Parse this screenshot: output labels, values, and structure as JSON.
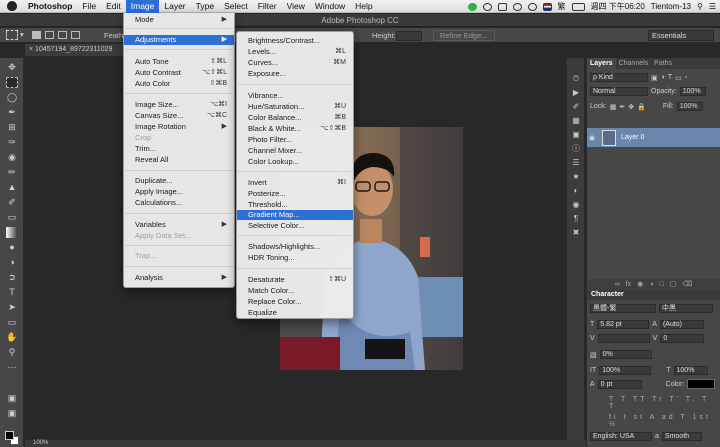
{
  "menubar": {
    "app": "Photoshop",
    "items": [
      "File",
      "Edit",
      "Image",
      "Layer",
      "Type",
      "Select",
      "Filter",
      "View",
      "Window",
      "Help"
    ],
    "active": "Image",
    "status": {
      "input": "繁",
      "clock": "週四 下午06:20",
      "user": "Tientom-13"
    }
  },
  "window": {
    "title": "Adobe Photoshop CC"
  },
  "options": {
    "feather_label": "Feath",
    "height_label": "Height:",
    "refine_label": "Refine Edge...",
    "workspace": "Essentials"
  },
  "document": {
    "tab": "10457194_89722311029",
    "zoom": "100%"
  },
  "image_menu": [
    {
      "label": "Mode",
      "submenu": true
    },
    {
      "label": "Adjustments",
      "submenu": true,
      "highlight": true
    },
    {
      "label": "Auto Tone",
      "shortcut": "⇧⌘L"
    },
    {
      "label": "Auto Contrast",
      "shortcut": "⌥⇧⌘L"
    },
    {
      "label": "Auto Color",
      "shortcut": "⇧⌘B"
    },
    {
      "label": "Image Size...",
      "shortcut": "⌥⌘I"
    },
    {
      "label": "Canvas Size...",
      "shortcut": "⌥⌘C"
    },
    {
      "label": "Image Rotation",
      "submenu": true
    },
    {
      "label": "Crop",
      "disabled": true
    },
    {
      "label": "Trim..."
    },
    {
      "label": "Reveal All"
    },
    {
      "label": "Duplicate..."
    },
    {
      "label": "Apply Image..."
    },
    {
      "label": "Calculations..."
    },
    {
      "label": "Variables",
      "submenu": true
    },
    {
      "label": "Apply Data Set...",
      "disabled": true
    },
    {
      "label": "Trap...",
      "disabled": true
    },
    {
      "label": "Analysis",
      "submenu": true
    }
  ],
  "adjustments_menu": [
    {
      "label": "Brightness/Contrast..."
    },
    {
      "label": "Levels...",
      "shortcut": "⌘L"
    },
    {
      "label": "Curves...",
      "shortcut": "⌘M"
    },
    {
      "label": "Exposure..."
    },
    {
      "label": "Vibrance..."
    },
    {
      "label": "Hue/Saturation...",
      "shortcut": "⌘U"
    },
    {
      "label": "Color Balance...",
      "shortcut": "⌘B"
    },
    {
      "label": "Black & White...",
      "shortcut": "⌥⇧⌘B"
    },
    {
      "label": "Photo Filter..."
    },
    {
      "label": "Channel Mixer..."
    },
    {
      "label": "Color Lookup..."
    },
    {
      "label": "Invert",
      "shortcut": "⌘I"
    },
    {
      "label": "Posterize..."
    },
    {
      "label": "Threshold..."
    },
    {
      "label": "Gradient Map...",
      "highlight": true
    },
    {
      "label": "Selective Color..."
    },
    {
      "label": "Shadows/Highlights..."
    },
    {
      "label": "HDR Toning..."
    },
    {
      "label": "Desaturate",
      "shortcut": "⇧⌘U"
    },
    {
      "label": "Match Color..."
    },
    {
      "label": "Replace Color..."
    },
    {
      "label": "Equalize"
    }
  ],
  "layers_panel": {
    "tabs": [
      "Layers",
      "Channels",
      "Paths"
    ],
    "kind": "ρ Kind",
    "blend_mode": "Normal",
    "opacity_label": "Opacity:",
    "opacity": "100%",
    "lock_label": "Lock:",
    "fill_label": "Fill:",
    "fill": "100%",
    "layer_name": "Layer 0"
  },
  "character_panel": {
    "title": "Character",
    "font": "黑體-繁",
    "style": "中黑",
    "size": "5.82 pt",
    "leading": "(Auto)",
    "tracking": "0",
    "scale_v": "0%",
    "vscale": "100%",
    "hscale": "100%",
    "baseline": "0 pt",
    "color_label": "Color:",
    "language": "English: USA",
    "aa_label": "a",
    "aa": "Smooth"
  },
  "colors": {
    "accent": "#2c6fd6",
    "layer_sel": "#6b86ad"
  }
}
